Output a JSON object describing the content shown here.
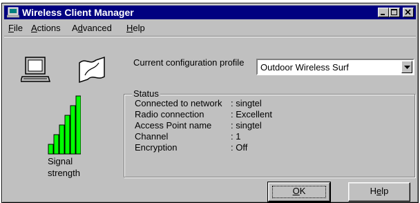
{
  "window": {
    "title": "Wireless Client Manager"
  },
  "menu": [
    {
      "label": "File",
      "mnemonic": "F",
      "rest": "ile"
    },
    {
      "label": "Actions",
      "mnemonic": "A",
      "rest": "ctions"
    },
    {
      "label": "Advanced",
      "pre": "A",
      "mnemonic": "d",
      "rest": "vanced"
    },
    {
      "label": "Help",
      "mnemonic": "H",
      "rest": "elp"
    }
  ],
  "config": {
    "label": "Current configuration profile",
    "selected": "Outdoor Wireless Surf"
  },
  "signal": {
    "label_line1": "Signal",
    "label_line2": "strength",
    "bars_lit": 6,
    "bars_total": 6
  },
  "status": {
    "legend": "Status",
    "rows": [
      {
        "label": "Connected to network",
        "value": ": singtel"
      },
      {
        "label": "Radio connection",
        "value": ": Excellent"
      },
      {
        "label": "Access Point name",
        "value": ": singtel"
      },
      {
        "label": "Channel",
        "value": ": 1"
      },
      {
        "label": "Encryption",
        "value": ": Off"
      }
    ]
  },
  "buttons": {
    "ok": "OK",
    "ok_mnemonic": "O",
    "ok_rest": "K",
    "help": "Help",
    "help_pre": "H",
    "help_mnemonic": "e",
    "help_rest": "lp"
  },
  "colors": {
    "titlebar": "#000080",
    "signal_bar": "#00ff00",
    "face": "#c0c0c0"
  }
}
